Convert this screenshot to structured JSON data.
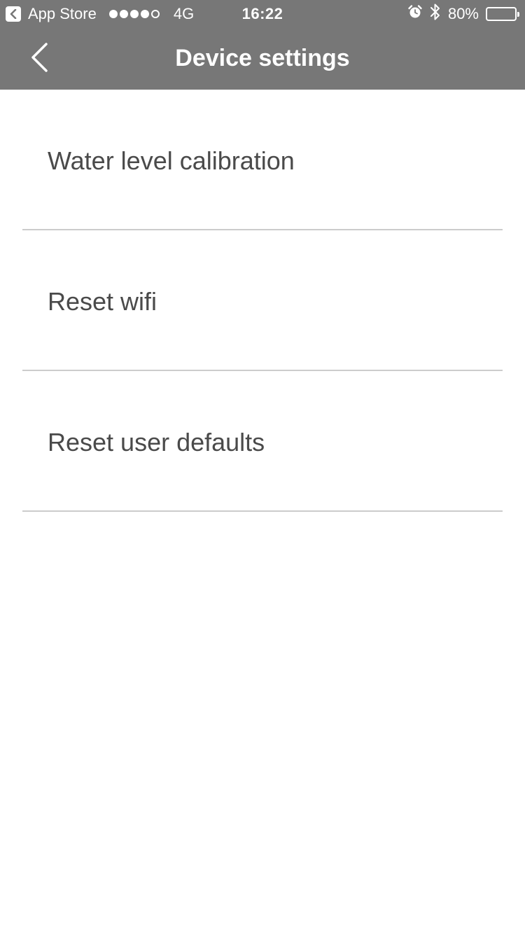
{
  "status_bar": {
    "back_app_label": "App Store",
    "signal_bars_filled": 4,
    "signal_bars_total": 5,
    "network": "4G",
    "time": "16:22",
    "battery_text": "80%",
    "battery_level": 0.8
  },
  "header": {
    "title": "Device settings",
    "back_icon": "chevron-left-icon"
  },
  "settings": {
    "items": [
      {
        "label": "Water level calibration"
      },
      {
        "label": "Reset wifi"
      },
      {
        "label": "Reset user defaults"
      }
    ]
  },
  "colors": {
    "header_bg": "#777777",
    "header_text": "#ffffff",
    "item_text": "#4a4a4a",
    "divider": "#cccccc",
    "background": "#ffffff"
  }
}
